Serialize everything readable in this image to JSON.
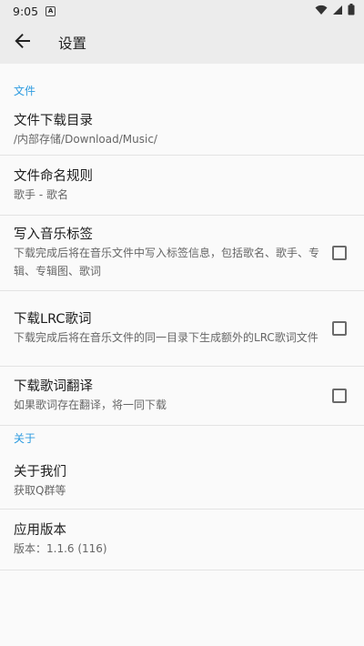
{
  "status": {
    "time": "9:05",
    "notif_glyph": "A",
    "icons": [
      "wifi-icon",
      "signal-icon",
      "battery-icon"
    ]
  },
  "toolbar": {
    "back_icon": "arrow-back-icon",
    "title": "设置"
  },
  "sections": [
    {
      "header": "文件",
      "items": [
        {
          "title": "文件下载目录",
          "summary": "/内部存储/Download/Music/",
          "checkbox": false
        },
        {
          "title": "文件命名规则",
          "summary": "歌手 - 歌名",
          "checkbox": false
        },
        {
          "title": "写入音乐标签",
          "summary": "下载完成后将在音乐文件中写入标签信息，包括歌名、歌手、专辑、专辑图、歌词",
          "checkbox": true,
          "checked": false
        },
        {
          "title": "下载LRC歌词",
          "summary": "下载完成后将在音乐文件的同一目录下生成额外的LRC歌词文件",
          "checkbox": true,
          "checked": false
        },
        {
          "title": "下载歌词翻译",
          "summary": "如果歌词存在翻译，将一同下载",
          "checkbox": true,
          "checked": false
        }
      ]
    },
    {
      "header": "关于",
      "items": [
        {
          "title": "关于我们",
          "summary": "获取Q群等",
          "checkbox": false
        },
        {
          "title": "应用版本",
          "summary": "版本：1.1.6 (116)",
          "checkbox": false
        }
      ]
    }
  ],
  "colors": {
    "accent": "#2d9be0",
    "toolbar_bg": "#ececec",
    "background": "#fafafa"
  }
}
